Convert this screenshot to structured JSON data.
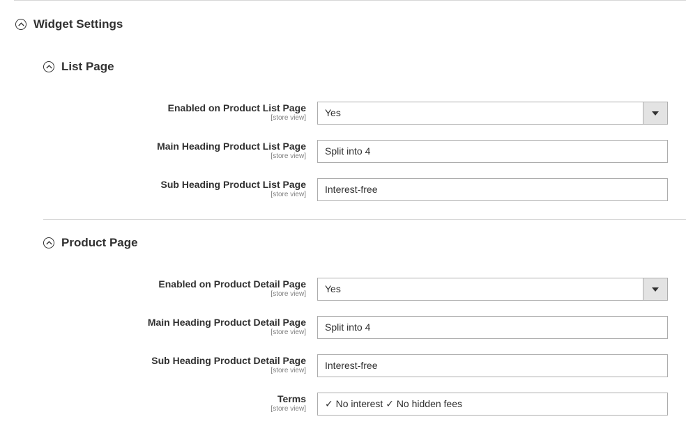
{
  "widget_settings": {
    "title": "Widget Settings"
  },
  "list_page": {
    "title": "List Page",
    "fields": [
      {
        "label": "Enabled on Product List Page",
        "scope": "[store view]",
        "type": "select",
        "value": "Yes"
      },
      {
        "label": "Main Heading Product List Page",
        "scope": "[store view]",
        "type": "text",
        "value": "Split into 4"
      },
      {
        "label": "Sub Heading Product List Page",
        "scope": "[store view]",
        "type": "text",
        "value": "Interest-free"
      }
    ]
  },
  "product_page": {
    "title": "Product Page",
    "fields": [
      {
        "label": "Enabled on Product Detail Page",
        "scope": "[store view]",
        "type": "select",
        "value": "Yes"
      },
      {
        "label": "Main Heading Product Detail Page",
        "scope": "[store view]",
        "type": "text",
        "value": "Split into 4"
      },
      {
        "label": "Sub Heading Product Detail Page",
        "scope": "[store view]",
        "type": "text",
        "value": "Interest-free"
      },
      {
        "label": "Terms",
        "scope": "[store view]",
        "type": "text",
        "value": "✓ No interest ✓ No hidden fees"
      }
    ]
  },
  "icons": {
    "collapse": "chevron-up-circle-icon",
    "dropdown": "caret-down-icon"
  }
}
